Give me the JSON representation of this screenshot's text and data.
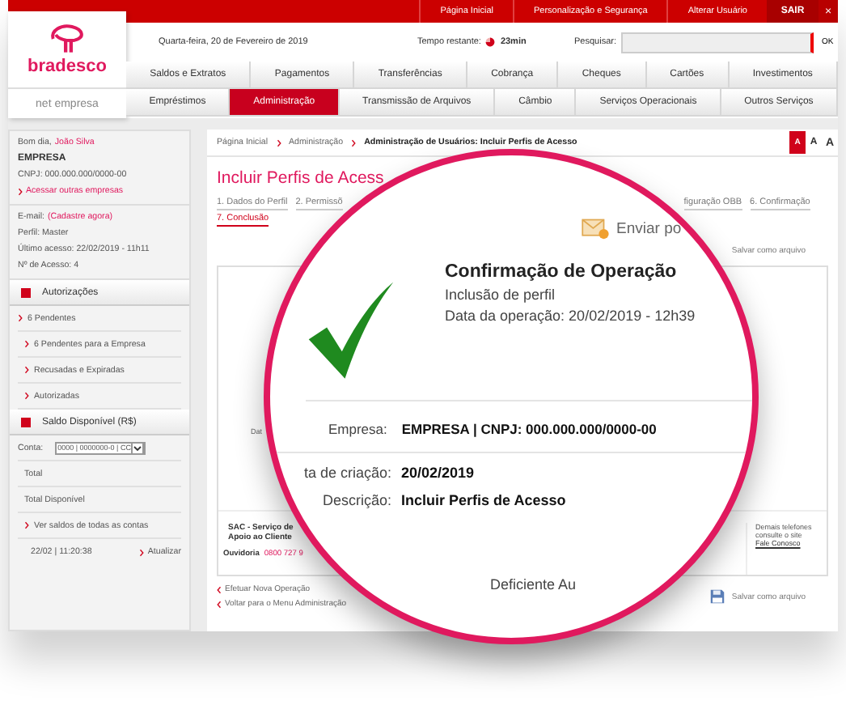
{
  "top_links": [
    {
      "label": "Página Inicial"
    },
    {
      "label": "Personalização e Segurança"
    },
    {
      "label": "Alterar Usuário"
    }
  ],
  "exit_button": "SAIR",
  "close_button": "×",
  "logo": {
    "name": "bradesco",
    "subtitle": "net empresa"
  },
  "date": "Quarta-feira, 20 de Fevereiro de 2019",
  "session": {
    "label": "Tempo restante:",
    "value": "23min"
  },
  "search": {
    "label": "Pesquisar:",
    "button": "OK"
  },
  "menu_rows": [
    [
      {
        "label": "Saldos e Extratos",
        "selected": false
      },
      {
        "label": "Pagamentos",
        "selected": false
      },
      {
        "label": "Transferências",
        "selected": false
      },
      {
        "label": "Cobrança",
        "selected": false
      },
      {
        "label": "Cheques",
        "selected": false
      },
      {
        "label": "Cartões",
        "selected": false
      },
      {
        "label": "Investimentos",
        "selected": false
      }
    ],
    [
      {
        "label": "Empréstimos",
        "selected": false
      },
      {
        "label": "Administração",
        "selected": true
      },
      {
        "label": "Transmissão de Arquivos",
        "selected": false
      },
      {
        "label": "Câmbio",
        "selected": false
      },
      {
        "label": "Serviços Operacionais",
        "selected": false
      },
      {
        "label": "Outros Serviços",
        "selected": false
      }
    ]
  ],
  "sidebar": {
    "greeting": "Bom dia,",
    "user": "João Silva",
    "company": "EMPRESA",
    "cnpj": "CNPJ: 000.000.000/0000-00",
    "switch_link": "Acessar outras empresas",
    "email_label": "E-mail:",
    "email_link": "(Cadastre agora)",
    "details": [
      "Perfil: Master",
      "Último acesso: 22/02/2019 - 11h11",
      "Nº de Acesso: 4"
    ],
    "authorizations": {
      "title": "Autorizações",
      "items": [
        "6 Pendentes",
        "6 Pendentes para a Empresa",
        "Recusadas e Expiradas",
        "Autorizadas"
      ]
    },
    "balance": {
      "title": "Saldo Disponível (R$)",
      "account_label": "Conta:",
      "account_value": "0000 | 0000000-0 | CC",
      "rows": [
        "Total",
        "Total Disponível"
      ],
      "all_accounts_link": "Ver saldos de todas as contas",
      "timestamp": "22/02 | 11:20:38",
      "refresh_link": "Atualizar"
    }
  },
  "breadcrumb": [
    {
      "label": "Página Inicial",
      "current": false
    },
    {
      "label": "Administração",
      "current": false
    },
    {
      "label": "Administração de Usuários: Incluir Perfis de Acesso",
      "current": true
    }
  ],
  "font_sizes": [
    {
      "label": "A",
      "selected": true
    },
    {
      "label": "A",
      "selected": false
    },
    {
      "label": "A",
      "selected": false
    }
  ],
  "page_title": "Incluir Perfis de Acess",
  "steps": [
    {
      "label": "1. Dados do Perfil",
      "selected": false
    },
    {
      "label": "2. Permissõ",
      "selected": false
    },
    {
      "label": "figuração OBB",
      "selected": false
    },
    {
      "label": "6. Confirmação",
      "selected": false
    },
    {
      "label": "7. Conclusão",
      "selected": true
    }
  ],
  "save_top": "Salvar como arquivo",
  "card_fragment": "Dat",
  "support": {
    "sac": "SAC - Serviço de Apoio ao Cliente",
    "ombudsman_label": "Ouvidoria",
    "ombudsman_phone": "0800 727 9",
    "other_phones": "Demais telefones consulte o site",
    "contact_link": "Fale Conosco"
  },
  "actions": [
    "Efetuar Nova Operação",
    "Voltar para o Menu Administração"
  ],
  "save_bottom": "Salvar como arquivo",
  "magnifier": {
    "send_label": "Enviar po",
    "title": "Confirmação de Operação",
    "subtitle": "Inclusão de perfil",
    "date": "Data da operação: 20/02/2019 - 12h39",
    "company_label": "Empresa:",
    "company_value": "EMPRESA | CNPJ: 000.000.000/0000-00",
    "fields": [
      {
        "label": "ta de criação:",
        "value": "20/02/2019"
      },
      {
        "label": "Descrição:",
        "value": "Incluir Perfis de Acesso"
      }
    ],
    "footer": "Deficiente Au"
  }
}
